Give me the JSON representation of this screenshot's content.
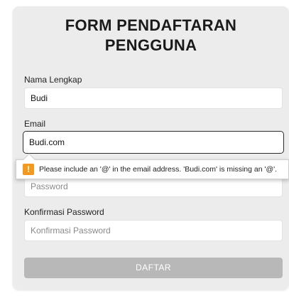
{
  "form": {
    "title_line1": "FORM PENDAFTARAN",
    "title_line2": "PENGGUNA",
    "name_label": "Nama Lengkap",
    "name_value": "Budi",
    "email_label": "Email",
    "email_value": "Budi.com",
    "password_placeholder": "Password",
    "confirm_label": "Konfirmasi Password",
    "confirm_placeholder": "Konfirmasi Password",
    "submit_label": "DAFTAR"
  },
  "validation": {
    "icon": "warning-icon",
    "icon_glyph": "!",
    "message": "Please include an '@' in the email address. 'Budi.com' is missing an '@'."
  },
  "colors": {
    "card_bg": "#ececec",
    "button_disabled": "#b8b8b8",
    "warning": "#f29a1f"
  }
}
